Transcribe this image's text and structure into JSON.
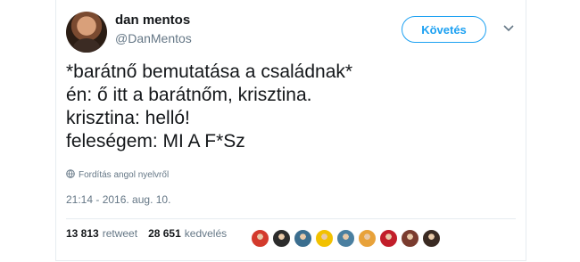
{
  "tweet": {
    "display_name": "dan mentos",
    "username": "@DanMentos",
    "follow_label": "Követés",
    "text_lines": [
      "*barátnő bemutatása a családnak*",
      "én: ő itt a barátnőm, krisztina.",
      "krisztina: helló!",
      "feleségem: MI A F*Sz"
    ],
    "translate_label": "Fordítás angol nyelvről",
    "timestamp": "21:14 - 2016. aug. 10.",
    "retweet_count": "13 813",
    "retweet_label": "retweet",
    "like_count": "28 651",
    "like_label": "kedvelés"
  },
  "colors": {
    "accent": "#1da1f2",
    "secondary_text": "#657786",
    "primary_text": "#14171a",
    "liker_avatars": [
      "#d33a2c",
      "#2c2c2c",
      "#3b6e8f",
      "#f2c100",
      "#4a7fa0",
      "#e8a23a",
      "#c21e2a",
      "#7a3b2e",
      "#3a2a22"
    ]
  },
  "icons": {
    "caret": "chevron-down-icon",
    "translate": "globe-icon"
  }
}
